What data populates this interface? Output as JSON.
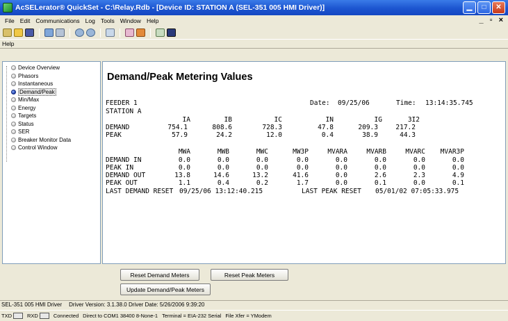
{
  "window": {
    "title": "AcSELerator® QuickSet - C:\\Relay.Rdb - [Device ID: STATION A (SEL-351 005 HMI Driver)]",
    "min": "▁",
    "max": "□",
    "close": "✕"
  },
  "menu": {
    "items": [
      "File",
      "Edit",
      "Communications",
      "Log",
      "Tools",
      "Window",
      "Help"
    ],
    "mdi_buttons": "_ ▫ ×"
  },
  "helpbar": {
    "label": "Help"
  },
  "nav": {
    "items": [
      "Device Overview",
      "Phasors",
      "Instantaneous",
      "Demand/Peak",
      "Min/Max",
      "Energy",
      "Targets",
      "Status",
      "SER",
      "Breaker Monitor Data",
      "Control Window"
    ],
    "selected_index": 3
  },
  "panel": {
    "title": "Demand/Peak Metering Values",
    "feeder": "FEEDER 1",
    "station": "STATION A",
    "date_label": "Date:",
    "date_value": "09/25/06",
    "time_label": "Time:",
    "time_value": "13:14:35.745",
    "table1": {
      "headers": [
        "IA",
        "IB",
        "IC",
        "IN",
        "IG",
        "3I2"
      ],
      "rows": [
        {
          "label": "DEMAND",
          "values": [
            "754.1",
            "808.6",
            "728.3",
            "47.8",
            "209.3",
            "217.2"
          ]
        },
        {
          "label": "PEAK",
          "values": [
            "57.9",
            "24.2",
            "12.0",
            "0.4",
            "38.9",
            "44.3"
          ]
        }
      ]
    },
    "table2": {
      "headers": [
        "MWA",
        "MWB",
        "MWC",
        "MW3P",
        "MVARA",
        "MVARB",
        "MVARC",
        "MVAR3P"
      ],
      "rows": [
        {
          "label": "DEMAND IN",
          "values": [
            "0.0",
            "0.0",
            "0.0",
            "0.0",
            "0.0",
            "0.0",
            "0.0",
            "0.0"
          ]
        },
        {
          "label": "PEAK IN",
          "values": [
            "0.0",
            "0.0",
            "0.0",
            "0.0",
            "0.0",
            "0.0",
            "0.0",
            "0.0"
          ]
        },
        {
          "label": "DEMAND OUT",
          "values": [
            "13.8",
            "14.6",
            "13.2",
            "41.6",
            "0.0",
            "2.6",
            "2.3",
            "4.9"
          ]
        },
        {
          "label": "PEAK OUT",
          "values": [
            "1.1",
            "0.4",
            "0.2",
            "1.7",
            "0.0",
            "0.1",
            "0.0",
            "0.1"
          ]
        }
      ]
    },
    "last_demand_reset_label": "LAST DEMAND RESET",
    "last_demand_reset_value": "09/25/06 13:12:40.215",
    "last_peak_reset_label": "LAST PEAK RESET",
    "last_peak_reset_value": "05/01/02 07:05:33.975"
  },
  "buttons": {
    "reset_demand": "Reset Demand Meters",
    "reset_peak": "Reset Peak Meters",
    "update": "Update Demand/Peak Meters"
  },
  "status": {
    "driver": "SEL-351 005 HMI Driver",
    "driver_version": "Driver Version: 3.1.38.0 Driver Date: 5/26/2006 9:39:20",
    "txd": "TXD",
    "rxd": "RXD",
    "connected": "Connected",
    "port": "Direct to COM1  38400  8-None-1",
    "terminal": "Terminal = EIA-232 Serial",
    "file_xfer": "File Xfer = YModem"
  }
}
